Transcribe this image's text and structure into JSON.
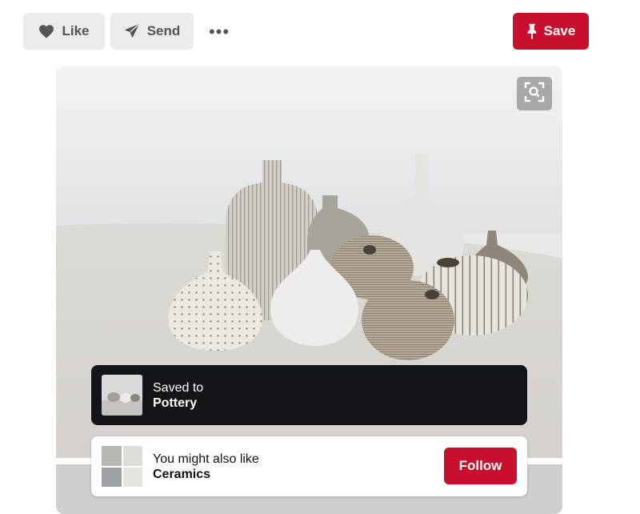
{
  "actions": {
    "like_label": "Like",
    "send_label": "Send",
    "more_label": "•••",
    "save_label": "Save"
  },
  "toast": {
    "prefix": "Saved to",
    "board": "Pottery"
  },
  "suggestion": {
    "prefix": "You might also like",
    "board": "Ceramics",
    "follow_label": "Follow"
  },
  "icons": {
    "like": "heart-icon",
    "send": "paper-plane-icon",
    "more": "ellipsis-icon",
    "save": "pushpin-icon",
    "lens": "visual-search-icon"
  },
  "colors": {
    "accent": "#c8102e",
    "toast_bg": "#121417",
    "button_gray": "#ececec"
  }
}
